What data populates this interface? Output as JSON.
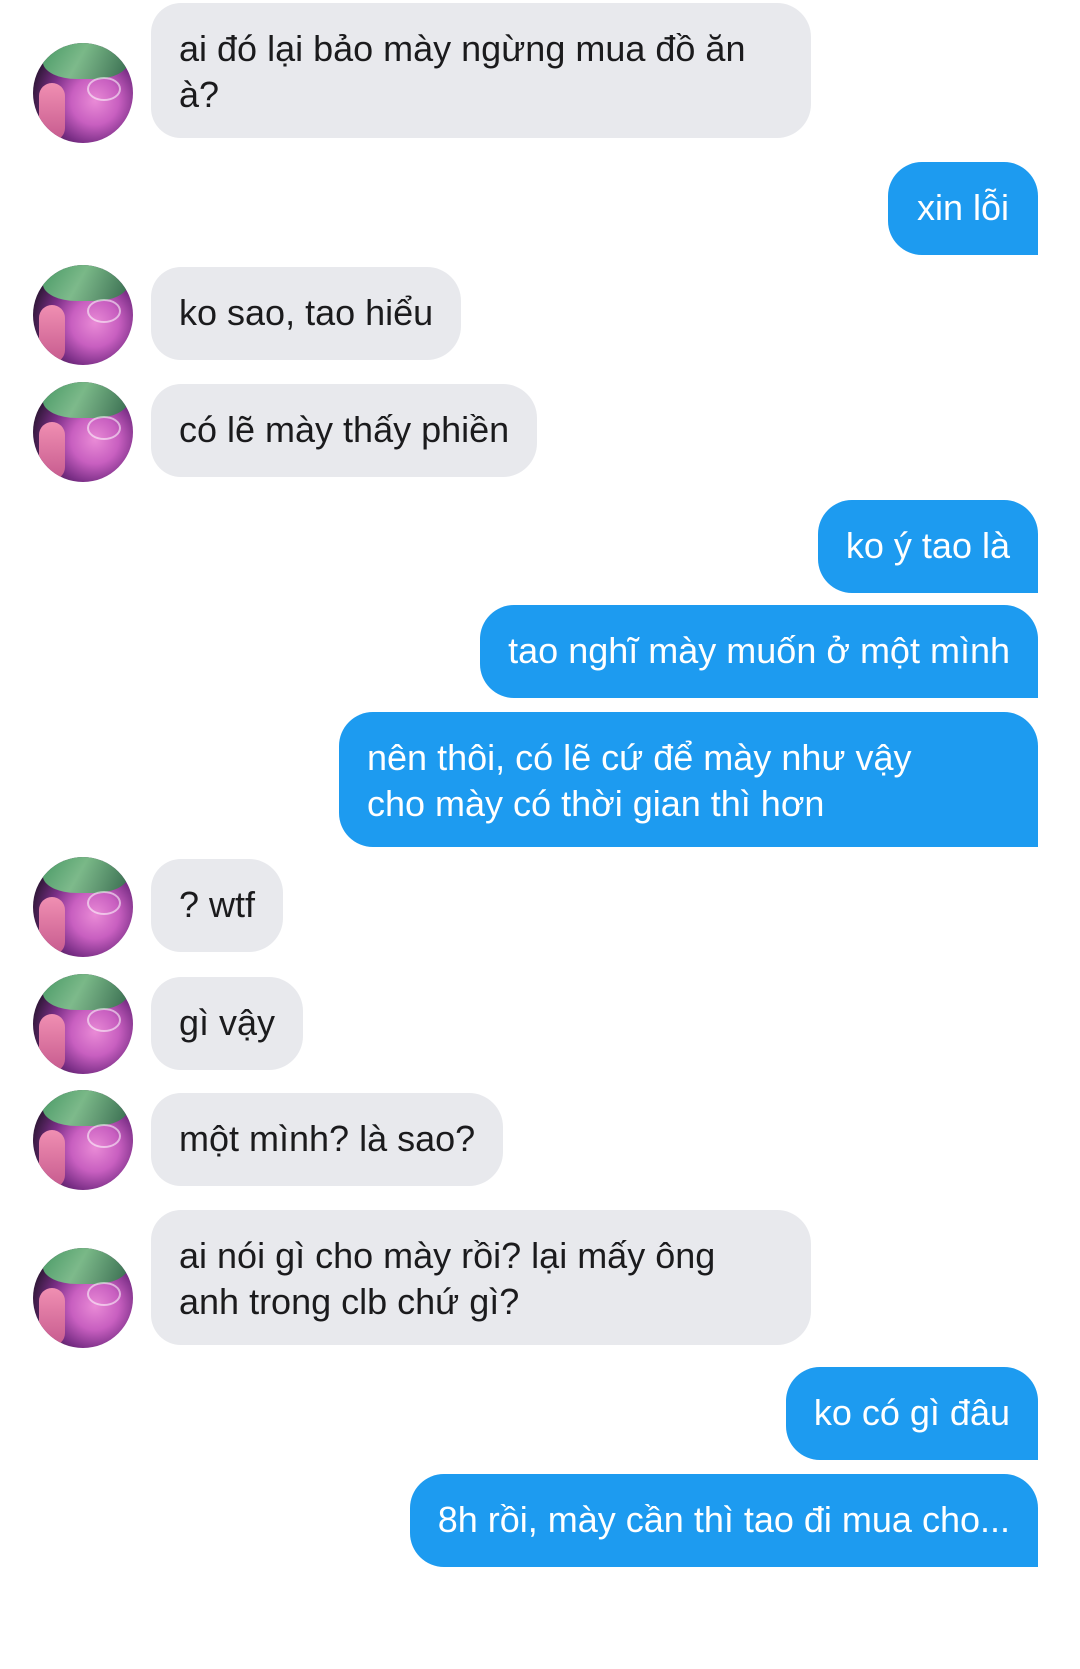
{
  "conversation": {
    "messages": [
      {
        "sender": "them",
        "text": "ai đó lại bảo mày ngừng mua đồ ăn\nà?"
      },
      {
        "sender": "me",
        "text": "xin lỗi"
      },
      {
        "sender": "them",
        "text": "ko sao, tao hiểu"
      },
      {
        "sender": "them",
        "text": "có lẽ mày thấy phiền"
      },
      {
        "sender": "me",
        "text": "ko ý tao là"
      },
      {
        "sender": "me",
        "text": "tao nghĩ mày muốn ở một mình"
      },
      {
        "sender": "me",
        "text": "nên thôi, có lẽ cứ để mày như vậy\ncho mày có thời gian thì hơn"
      },
      {
        "sender": "them",
        "text": "? wtf"
      },
      {
        "sender": "them",
        "text": "gì vậy"
      },
      {
        "sender": "them",
        "text": "một mình? là sao?"
      },
      {
        "sender": "them",
        "text": "ai nói gì cho mày rồi? lại mấy ông\nanh trong clb chứ gì?"
      },
      {
        "sender": "me",
        "text": "ko có gì đâu"
      },
      {
        "sender": "me",
        "text": "8h rồi, mày cần thì tao đi mua cho..."
      }
    ]
  },
  "colors": {
    "outgoing_bubble": "#1d9bf0",
    "incoming_bubble": "#e8e9ed",
    "incoming_text": "#1b1b1d",
    "outgoing_text": "#ffffff"
  }
}
